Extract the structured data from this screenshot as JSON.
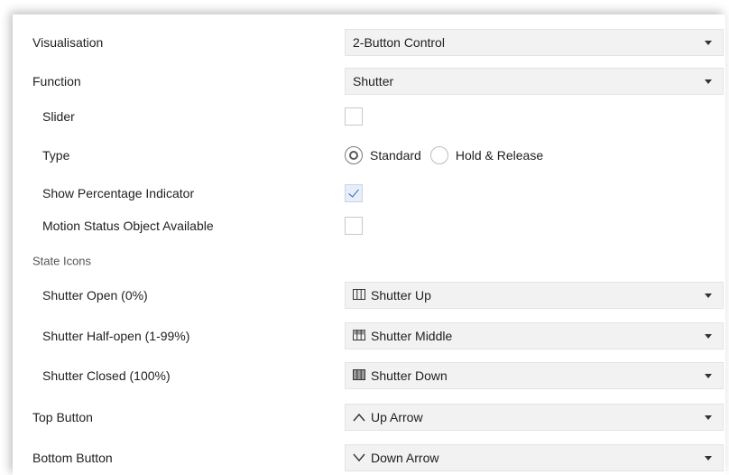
{
  "rows": {
    "visualisation": {
      "label": "Visualisation",
      "value": "2-Button Control"
    },
    "function": {
      "label": "Function",
      "value": "Shutter"
    },
    "slider": {
      "label": "Slider",
      "checked": false
    },
    "type": {
      "label": "Type",
      "options": [
        "Standard",
        "Hold & Release"
      ],
      "selected": "Standard"
    },
    "show_percentage": {
      "label": "Show Percentage Indicator",
      "checked": true
    },
    "motion_status": {
      "label": "Motion Status Object Available",
      "checked": false
    },
    "state_icons": {
      "label": "State Icons"
    },
    "shutter_open": {
      "label": "Shutter Open (0%)",
      "value": "Shutter Up",
      "icon": "shutter-up-icon"
    },
    "shutter_half": {
      "label": "Shutter Half-open (1-99%)",
      "value": "Shutter Middle",
      "icon": "shutter-middle-icon"
    },
    "shutter_closed": {
      "label": "Shutter Closed (100%)",
      "value": "Shutter Down",
      "icon": "shutter-down-icon"
    },
    "top_button": {
      "label": "Top Button",
      "value": "Up Arrow",
      "icon": "up-arrow-icon"
    },
    "bottom_button": {
      "label": "Bottom Button",
      "value": "Down Arrow",
      "icon": "down-arrow-icon"
    }
  },
  "colors": {
    "accent": "#2f66c5",
    "select_bg": "#f2f2f2",
    "checked_bg": "#e6eef9"
  }
}
